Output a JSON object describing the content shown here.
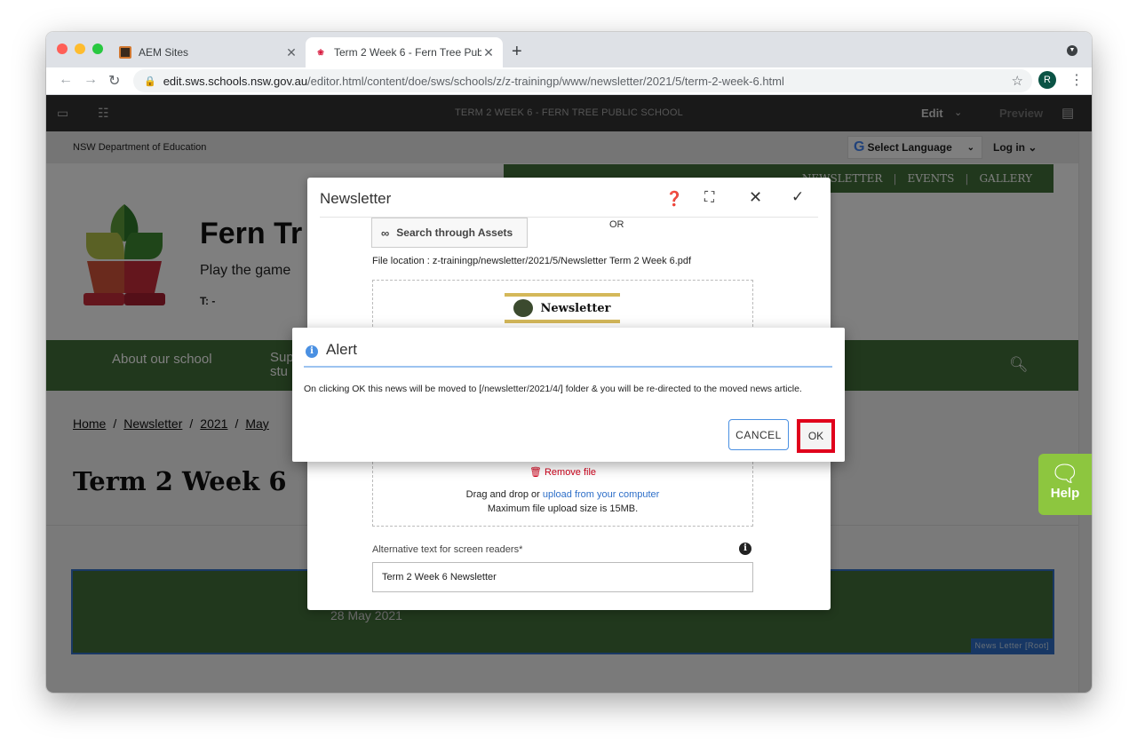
{
  "browser": {
    "tabs": [
      {
        "title": "AEM Sites",
        "icon": "aem-favicon",
        "active": false
      },
      {
        "title": "Term 2 Week 6 - Fern Tree Pub",
        "icon": "nsw-favicon",
        "active": true
      }
    ],
    "new_tab": "+",
    "close_glyph": "✕",
    "url_host": "edit.sws.schools.nsw.gov.au",
    "url_path": "/editor.html/content/doe/sws/schools/z/z-trainingp/www/newsletter/2021/5/term-2-week-6.html",
    "profile_initial": "R"
  },
  "aem_toolbar": {
    "page_title": "TERM 2 WEEK 6 - FERN TREE PUBLIC SCHOOL",
    "mode": "Edit",
    "preview": "Preview"
  },
  "site": {
    "department": "NSW Department of Education",
    "language_select": "Select Language",
    "login": "Log in",
    "top_nav": [
      "NEWSLETTER",
      "EVENTS",
      "GALLERY"
    ],
    "school_name": "Fern Tr",
    "tagline": "Play the game",
    "phone": "T: -",
    "main_nav": [
      "About our school",
      "Sup stu"
    ],
    "breadcrumb": [
      "Home",
      "Newsletter",
      "2021",
      "May"
    ],
    "page_title": "Term 2 Week 6",
    "news_date": "28 May 2021",
    "component_tag": "News Letter [Root]",
    "help_label": "Help"
  },
  "newsletter_dialog": {
    "title": "Newsletter",
    "search_assets": "Search through Assets",
    "or": "OR",
    "file_location": "File location : z-trainingp/newsletter/2021/5/Newsletter Term 2 Week 6.pdf",
    "thumbnail_title": "Newsletter",
    "remove_file": "Remove file",
    "drag_drop_prefix": "Drag and drop or ",
    "upload_link": "upload from your computer",
    "max_size": "Maximum file upload size is 15MB.",
    "alt_label": "Alternative text for screen readers*",
    "alt_value": "Term 2 Week 6 Newsletter"
  },
  "alert": {
    "title": "Alert",
    "message": "On clicking OK this news will be moved to [/newsletter/2021/4/] folder & you will be re-directed to the moved news article.",
    "cancel": "CANCEL",
    "ok": "OK",
    "highlight_color": "#e0001b"
  }
}
